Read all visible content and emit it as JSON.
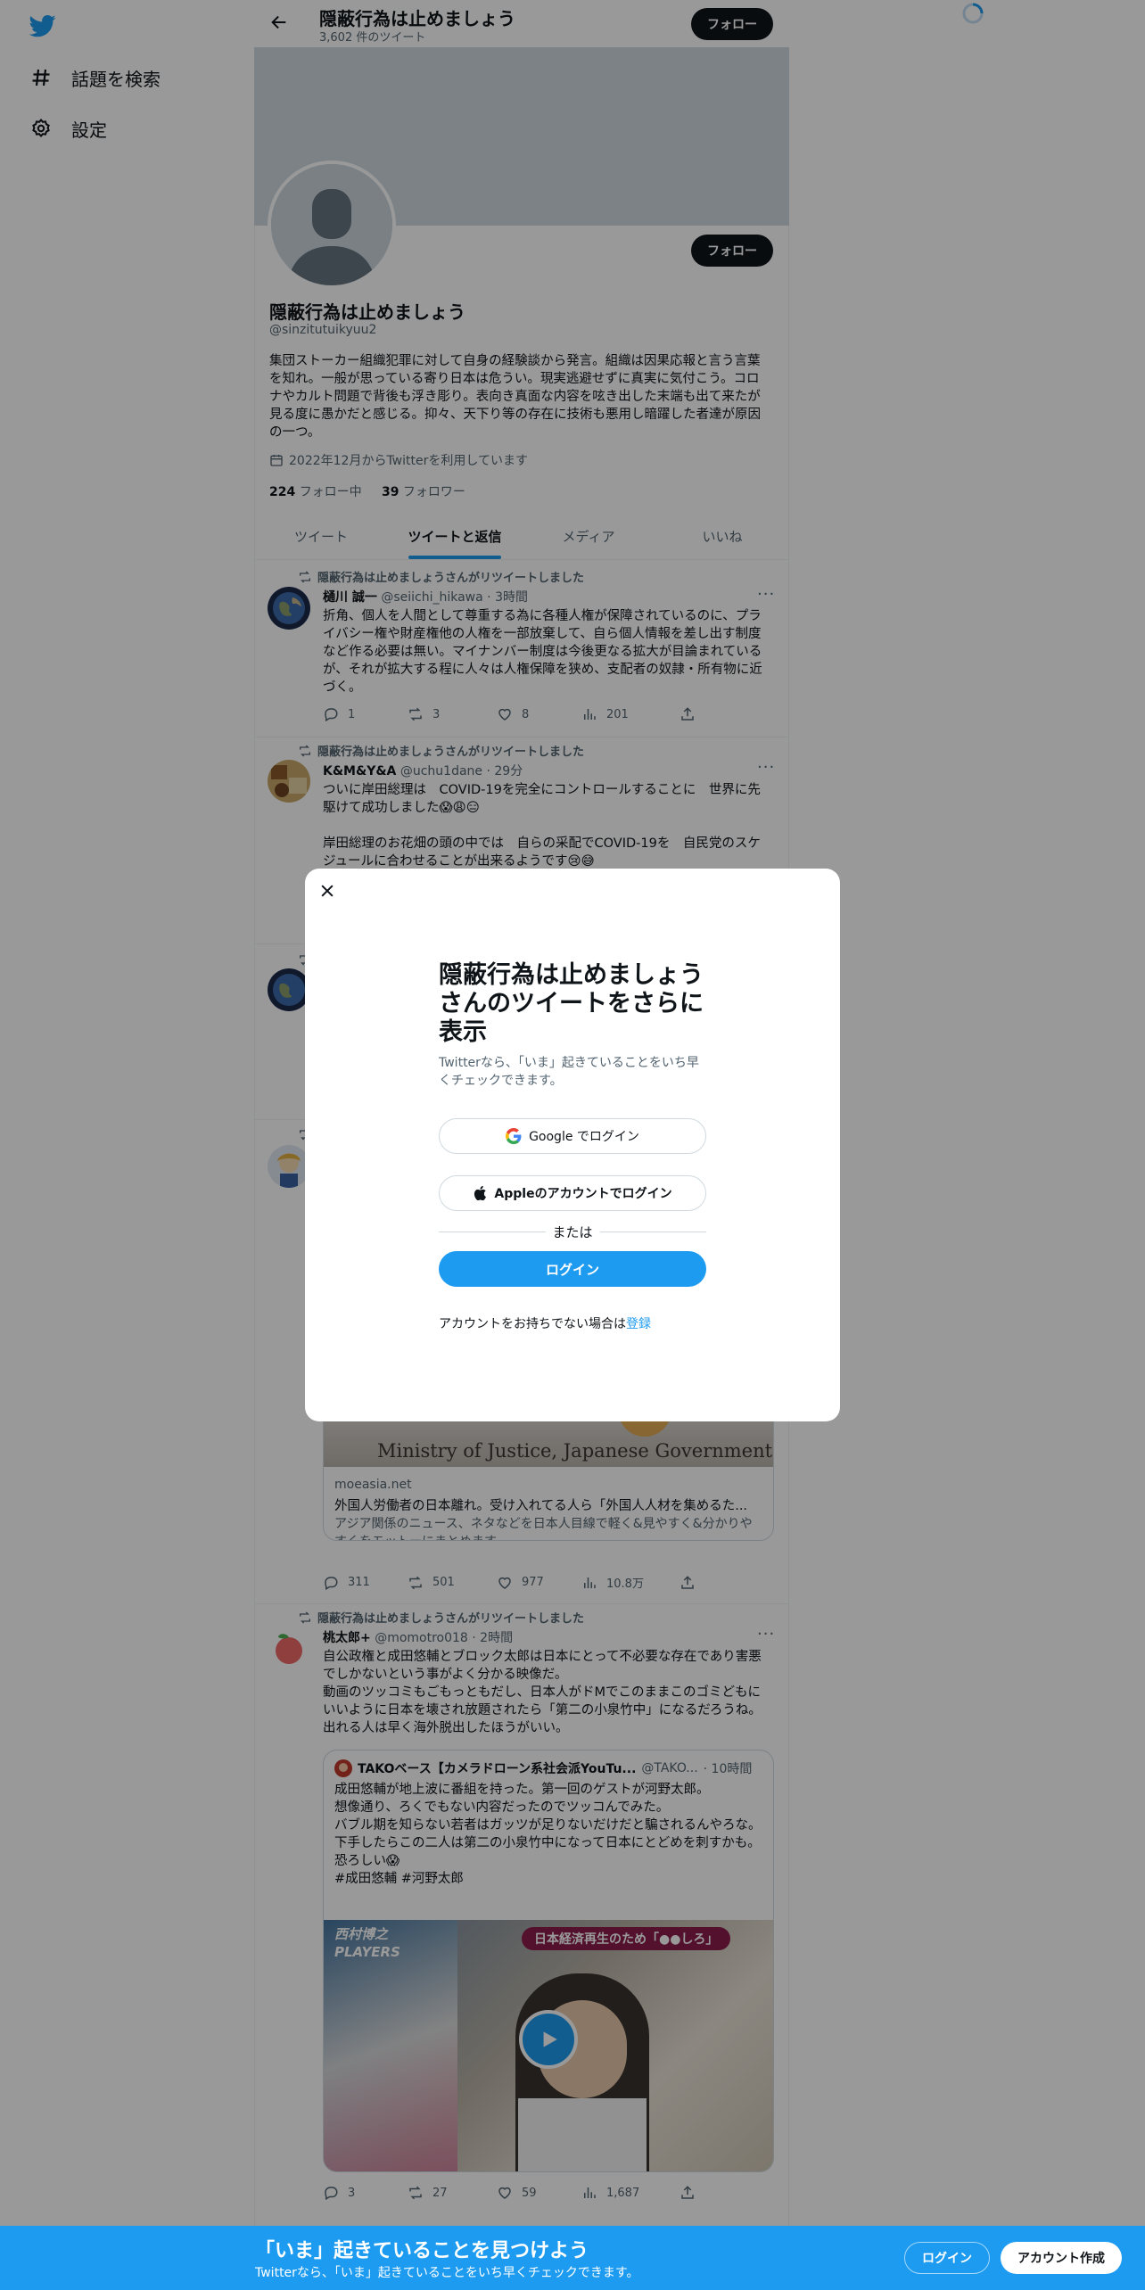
{
  "nav": {
    "explore_label": "話題を検索",
    "settings_label": "設定"
  },
  "header": {
    "title": "隠蔽行為は止めましょう",
    "tweet_count": "3,602 件のツイート",
    "follow_label": "フォロー"
  },
  "profile": {
    "name": "隠蔽行為は止めましょう",
    "handle": "@sinzitutuikyuu2",
    "bio": "集団ストーカー組織犯罪に対して自身の経験談から発言。組織は因果応報と言う言葉を知れ。一般が思っている寄り日本は危うい。現実逃避せずに真実に気付こう。コロナやカルト問題で背後も浮き彫り。表向き真面な内容を呟き出した末端も出て来たが見る度に愚かだと感じる。抑々、天下り等の存在に技術も悪用し暗躍した者達が原因の一つ。",
    "joined": "2022年12月からTwitterを利用しています",
    "following_count": "224",
    "following_label": "フォロー中",
    "followers_count": "39",
    "followers_label": "フォロワー",
    "follow_label": "フォロー"
  },
  "tabs": [
    {
      "label": "ツイート"
    },
    {
      "label": "ツイートと返信"
    },
    {
      "label": "メディア"
    },
    {
      "label": "いいね"
    }
  ],
  "tweets": [
    {
      "retweet_by": "隠蔽行為は止めましょうさんがリツイートしました",
      "name": "樋川 誠一",
      "handle": "@seiichi_hikawa",
      "time": "· 3時間",
      "text": "折角、個人を人間として尊重する為に各種人権が保障されているのに、プライバシー権や財産権他の人権を一部放棄して、自ら個人情報を差し出す制度など作る必要は無い。マイナンバー制度は今後更なる拡大が目論まれているが、それが拡大する程に人々は人権保障を狭め、支配者の奴隷・所有物に近づく。",
      "replies": "1",
      "retweets": "3",
      "likes": "8",
      "views": "201"
    },
    {
      "retweet_by": "隠蔽行為は止めましょうさんがリツイートしました",
      "name": "K&M&Y&A",
      "handle": "@uchu1dane",
      "time": "· 29分",
      "text": "ついに岸田総理は　COVID-19を完全にコントロールすることに　世界に先駆けて成功しました😱😩😑\n\n岸田総理のお花畑の頭の中では　自らの采配でCOVID-19を　自民党のスケジュールに合わせることが出来るようです😢😅"
    },
    {
      "card_domain": "moeasia.net",
      "card_title": "外国人労働者の日本離れ。受け入れてる人ら「外国人人材を集めるた...",
      "card_desc": "アジア関係のニュース、ネタなどを日本人目線で軽く&見やすく&分かりやすくをモットーにまとめます",
      "card_image_text": "Ministry of Justice, Japanese Government",
      "replies": "311",
      "retweets": "501",
      "likes": "977",
      "views": "10.8万"
    },
    {
      "retweet_by": "隠蔽行為は止めましょうさんがリツイートしました",
      "name": "桃太郎+",
      "handle": "@momotro018",
      "time": "· 2時間",
      "text": "自公政権と成田悠輔とブロック太郎は日本にとって不必要な存在であり害悪でしかないという事がよく分かる映像だ。\n動画のツッコミもごもっともだし、日本人がドMでこのままこのゴミどもにいいように日本を壊され放題されたら「第二の小泉竹中」になるだろうね。出れる人は早く海外脱出したほうがいい。",
      "quote_name": "TAKOベース【カメラドローン系社会派YouTu...",
      "quote_handle": "@TAKO...",
      "quote_time": "· 10時間",
      "quote_text": "成田悠輔が地上波に番組を持った。第一回のゲストが河野太郎。\n想像通り、ろくでもない内容だったのでツッコんでみた。\nバブル期を知らない若者はガッツが足りないだけだと騙されるんやろな。\n下手したらこの二人は第二の小泉竹中になって日本にとどめを刺すかも。恐ろしい😱\n#成田悠輔 #河野太郎",
      "video_badge": "日本経済再生のため「●●しろ」",
      "video_logo": "西村博之 PLAYERS",
      "replies": "3",
      "retweets": "27",
      "likes": "59",
      "views": "1,687"
    }
  ],
  "modal": {
    "title": "隠蔽行為は止めましょうさんのツイートをさらに表示",
    "subtitle": "Twitterなら、「いま」起きていることをいち早くチェックできます。",
    "google_label": "Google でログイン",
    "apple_label": "Appleのアカウントでログイン",
    "or_label": "または",
    "login_label": "ログイン",
    "signup_prefix": "アカウントをお持ちでない場合は",
    "signup_link": "登録"
  },
  "bottom_bar": {
    "title": "「いま」起きていることを見つけよう",
    "subtitle": "Twitterなら、「いま」起きていることをいち早くチェックできます。",
    "login_label": "ログイン",
    "signup_label": "アカウント作成"
  },
  "colors": {
    "accent": "#1d9bf0",
    "text": "#0f1419",
    "muted": "#536471"
  }
}
